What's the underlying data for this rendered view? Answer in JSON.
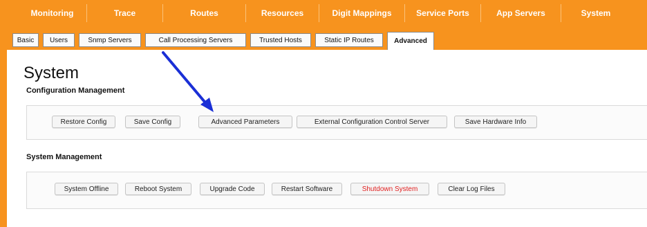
{
  "top_tabs": [
    {
      "label": "Monitoring"
    },
    {
      "label": "Trace"
    },
    {
      "label": "Routes"
    },
    {
      "label": "Resources"
    },
    {
      "label": "Digit Mappings"
    },
    {
      "label": "Service Ports"
    },
    {
      "label": "App Servers"
    },
    {
      "label": "System"
    }
  ],
  "sub_tabs": [
    {
      "label": "Basic"
    },
    {
      "label": "Users"
    },
    {
      "label": "Snmp Servers"
    },
    {
      "label": "Call Processing Servers"
    },
    {
      "label": "Trusted Hosts"
    },
    {
      "label": "Static IP Routes"
    },
    {
      "label": "Advanced"
    }
  ],
  "page": {
    "title": "System",
    "config_section": {
      "title": "Configuration Management",
      "buttons": [
        {
          "label": "Restore Config"
        },
        {
          "label": "Save Config"
        },
        {
          "label": "Advanced Parameters"
        },
        {
          "label": "External Configuration Control Server"
        },
        {
          "label": "Save Hardware Info"
        }
      ]
    },
    "system_section": {
      "title": "System Management",
      "buttons": [
        {
          "label": "System Offline"
        },
        {
          "label": "Reboot System"
        },
        {
          "label": "Upgrade Code"
        },
        {
          "label": "Restart Software"
        },
        {
          "label": "Shutdown System"
        },
        {
          "label": "Clear Log Files"
        }
      ]
    }
  },
  "colors": {
    "brand_orange": "#f7931e",
    "danger_red": "#e02020",
    "annotation_arrow": "#1a2fd6"
  },
  "annotation": {
    "icon": "arrow-icon"
  }
}
